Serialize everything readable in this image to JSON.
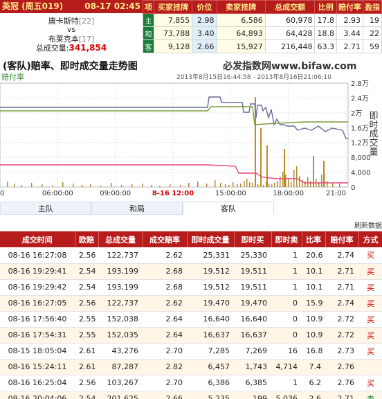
{
  "header": {
    "league": "英冠 (周五019)",
    "datetime": "08-17 02:45",
    "home_team": "唐卡斯特",
    "home_rank": "[22]",
    "vs": "vs",
    "away_team": "布莱克本",
    "away_rank": "[17]",
    "total_volume_label": "总成交量:",
    "total_volume": "341,854"
  },
  "summary": {
    "headers": [
      "项",
      "买家挂牌",
      "价位",
      "卖家挂牌",
      "总成交额",
      "比例",
      "赔付率",
      "盈指"
    ],
    "rows": [
      {
        "tag": "主",
        "buy": "7,855",
        "price": "2.98",
        "sell": "6,586",
        "total": "60,978",
        "ratio": "17.8",
        "payout": "2.93",
        "extra": "19"
      },
      {
        "tag": "和",
        "buy": "73,788",
        "price": "3.40",
        "sell": "64,893",
        "total": "64,428",
        "ratio": "18.8",
        "payout": "3.44",
        "extra": "22"
      },
      {
        "tag": "客",
        "buy": "9,128",
        "price": "2.66",
        "sell": "15,927",
        "total": "216,448",
        "ratio": "63.3",
        "payout": "2.71",
        "extra": "59"
      }
    ]
  },
  "chart_title": "(客队)赔率、即时成交量走势图",
  "site_label": "必发指数网www.bifaw.com",
  "chart_data": {
    "type": "line",
    "date_range": "2013年8月15日16:44:58 - 2013年8月16日21:06:10",
    "left_axis_label": "赔付率",
    "right_axis_label": "即时成交量",
    "right_ticks": [
      "2.8万",
      "2.4万",
      "2万",
      "1.6万",
      "1.2万",
      "8,000",
      "4,000",
      "0"
    ],
    "x_ticks": [
      "0",
      "06:00:00",
      "09:00:00",
      "8-16 12:00",
      "15:00:00",
      "18:00:00",
      "21:00"
    ],
    "series": [
      {
        "color": "#7a7aa8",
        "x": [
          0,
          12,
          15,
          16,
          18,
          20.5,
          22,
          24,
          31,
          33,
          33.5,
          34,
          41,
          42,
          43,
          44.5,
          45,
          47,
          47.5,
          48,
          52,
          54,
          56,
          57,
          57.5,
          60,
          62,
          64,
          65,
          66.5,
          68,
          69,
          70,
          74,
          77,
          78.5,
          81,
          81.5,
          82,
          85,
          90,
          93,
          94,
          97,
          100
        ],
        "y": [
          2.98,
          2.98,
          2.98,
          2.98,
          2.98,
          2.98,
          2.98,
          2.98,
          2.98,
          2.98,
          2.98,
          2.98,
          2.98,
          2.98,
          2.98,
          2.98,
          2.98,
          2.98,
          2.98,
          2.98,
          2.98,
          2.98,
          2.98,
          2.98,
          2.98,
          2.98,
          2.98,
          2.98,
          2.98,
          2.98,
          2.98,
          2.98,
          2.98,
          2.98,
          2.98,
          2.98,
          2.98,
          2.98,
          2.98,
          2.98,
          2.98,
          2.98,
          2.98,
          2.98,
          2.98
        ]
      },
      {
        "color": "#7a9a3a",
        "x": [
          0,
          20,
          40,
          60,
          70,
          80,
          90,
          100
        ],
        "y": [
          3.4,
          3.4,
          3.4,
          3.4,
          3.4,
          3.4,
          3.4,
          3.4
        ]
      },
      {
        "color": "#e8487a",
        "x": [
          0,
          20,
          40,
          60,
          70,
          80,
          90,
          100
        ],
        "y": [
          2.66,
          2.66,
          2.66,
          2.66,
          2.66,
          2.66,
          2.66,
          2.66
        ]
      }
    ]
  },
  "tabs": [
    "主队",
    "和局",
    "客队"
  ],
  "refresh_label": "刷新数据",
  "trades": {
    "headers": [
      "成交时间",
      "欧赔",
      "总成交量",
      "成交赔率",
      "即时成交量",
      "即时买",
      "即时卖",
      "比率",
      "赔付率",
      "方式"
    ],
    "rows": [
      [
        "08-16 16:27:08",
        "2.56",
        "122,737",
        "2.62",
        "25,331",
        "25,330",
        "1",
        "20.6",
        "2.74",
        "买"
      ],
      [
        "08-16 19:29:41",
        "2.54",
        "193,199",
        "2.68",
        "19,512",
        "19,511",
        "1",
        "10.1",
        "2.71",
        "买"
      ],
      [
        "08-16 19:29:42",
        "2.54",
        "193,199",
        "2.68",
        "19,512",
        "19,511",
        "1",
        "10.1",
        "2.71",
        "买"
      ],
      [
        "08-16 16:27:05",
        "2.56",
        "122,737",
        "2.62",
        "19,470",
        "19,470",
        "0",
        "15.9",
        "2.74",
        "买"
      ],
      [
        "08-16 17:56:40",
        "2.55",
        "152,038",
        "2.64",
        "16,640",
        "16,640",
        "0",
        "10.9",
        "2.72",
        "买"
      ],
      [
        "08-16 17:54:31",
        "2.55",
        "152,035",
        "2.64",
        "16,637",
        "16,637",
        "0",
        "10.9",
        "2.72",
        "买"
      ],
      [
        "08-15 18:05:04",
        "2.61",
        "43,276",
        "2.70",
        "7,285",
        "7,269",
        "16",
        "16.8",
        "2.73",
        "买"
      ],
      [
        "08-16 15:24:11",
        "2.61",
        "87,287",
        "2.82",
        "6,457",
        "1,743",
        "4,714",
        "7.4",
        "2.76",
        ""
      ],
      [
        "08-16 16:25:04",
        "2.56",
        "103,267",
        "2.70",
        "6,386",
        "6,385",
        "1",
        "6.2",
        "2.76",
        "买"
      ],
      [
        "08-16 20:04:06",
        "2.54",
        "201,625",
        "2.66",
        "5,235",
        "199",
        "5,036",
        "2.6",
        "2.71",
        "卖"
      ]
    ]
  }
}
